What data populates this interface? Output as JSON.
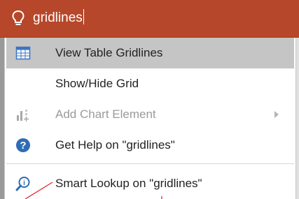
{
  "search": {
    "query": "gridlines",
    "icon": "lightbulb-icon"
  },
  "menu": {
    "items": [
      {
        "label": "View Table Gridlines",
        "icon": "table-gridlines-icon",
        "state": "selected"
      },
      {
        "label": "Show/Hide Grid",
        "icon": "",
        "state": "normal"
      },
      {
        "label": "Add Chart Element",
        "icon": "add-chart-element-icon",
        "state": "disabled",
        "submenu": true
      },
      {
        "label": "Get Help on \"gridlines\"",
        "icon": "help-icon",
        "state": "normal"
      },
      {
        "label": "Smart Lookup on \"gridlines\"",
        "icon": "smart-lookup-icon",
        "state": "normal"
      }
    ]
  },
  "colors": {
    "search_bar": "#b7472a",
    "selected_row": "#c5c5c5",
    "help_icon": "#2f6db5",
    "annotation": "#e8202a"
  }
}
